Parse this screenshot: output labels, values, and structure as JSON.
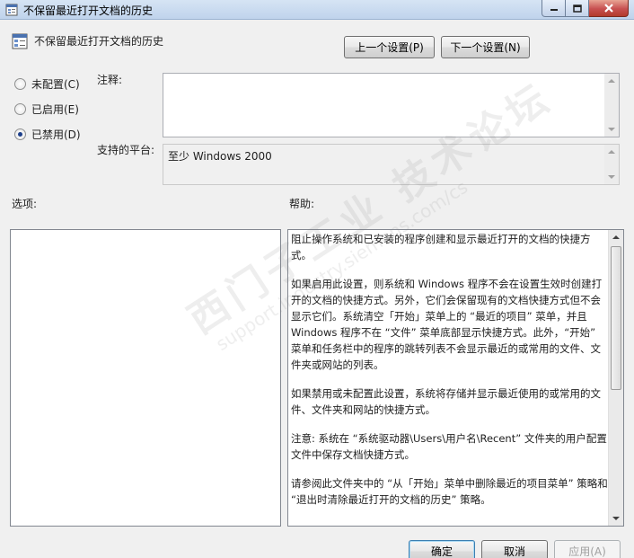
{
  "window": {
    "title": "不保留最近打开文档的历史"
  },
  "header": {
    "policy_name": "不保留最近打开文档的历史",
    "prev_button": "上一个设置(P)",
    "next_button": "下一个设置(N)"
  },
  "state": {
    "options": [
      {
        "label": "未配置(C)",
        "checked": false
      },
      {
        "label": "已启用(E)",
        "checked": false
      },
      {
        "label": "已禁用(D)",
        "checked": true
      }
    ]
  },
  "comment": {
    "label": "注释:",
    "value": ""
  },
  "platform": {
    "label": "支持的平台:",
    "value": "至少 Windows 2000"
  },
  "options_section": {
    "label": "选项:"
  },
  "help_section": {
    "label": "帮助:",
    "paragraphs": [
      "阻止操作系统和已安装的程序创建和显示最近打开的文档的快捷方式。",
      "如果启用此设置，则系统和 Windows 程序不会在设置生效时创建打开的文档的快捷方式。另外，它们会保留现有的文档快捷方式但不会显示它们。系统清空「开始」菜单上的 “最近的项目” 菜单，并且 Windows 程序不在 “文件” 菜单底部显示快捷方式。此外，“开始” 菜单和任务栏中的程序的跳转列表不会显示最近的或常用的文件、文件夹或网站的列表。",
      "如果禁用或未配置此设置，系统将存储并显示最近使用的或常用的文件、文件夹和网站的快捷方式。",
      "注意: 系统在 “系统驱动器\\Users\\用户名\\Recent” 文件夹的用户配置文件中保存文档快捷方式。",
      "请参阅此文件夹中的 “从「开始」菜单中删除最近的项目菜单” 策略和 “退出时清除最近打开的文档的历史” 策略。"
    ]
  },
  "footer": {
    "ok_button": "确定",
    "cancel_button": "取消",
    "apply_button": "应用(A)"
  },
  "watermark": {
    "line1": "西门子工业 技术论坛",
    "line2": "support.industry.siemens.com/cs"
  },
  "colors": {
    "titlebar": "#c8dbf1",
    "dialog_bg": "#f0f0f0",
    "close_button": "#c75050",
    "radio_dot": "#1d3f8a"
  }
}
